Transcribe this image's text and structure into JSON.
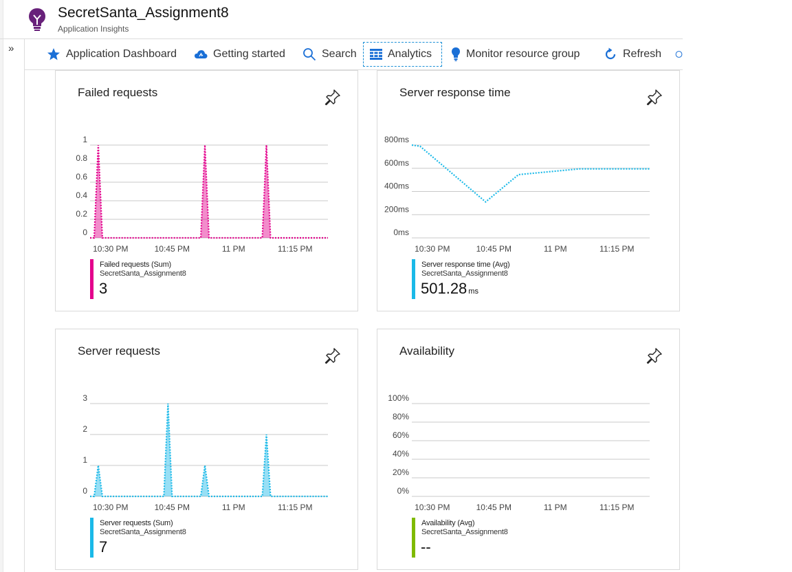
{
  "header": {
    "title": "SecretSanta_Assignment8",
    "subtitle": "Application Insights"
  },
  "nav": {
    "collapse_glyph": "»"
  },
  "toolbar": {
    "items": [
      {
        "label": "Application Dashboard",
        "icon": "star-icon"
      },
      {
        "label": "Getting started",
        "icon": "cloud-icon"
      },
      {
        "label": "Search",
        "icon": "search-icon"
      },
      {
        "label": "Analytics",
        "icon": "grid-icon",
        "active": true
      },
      {
        "label": "Monitor resource group",
        "icon": "bulb-icon"
      },
      {
        "label": "Refresh",
        "icon": "refresh-icon"
      }
    ]
  },
  "colors": {
    "magenta": "#e3008c",
    "cyan": "#1ab9e8",
    "green": "#7fba00",
    "accent": "#1a8fd6"
  },
  "tiles": [
    {
      "title": "Failed requests",
      "legend": {
        "label": "Failed requests (Sum)",
        "resource": "SecretSanta_Assignment8",
        "value": "3",
        "unit": ""
      }
    },
    {
      "title": "Server response time",
      "legend": {
        "label": "Server response time (Avg)",
        "resource": "SecretSanta_Assignment8",
        "value": "501.28",
        "unit": "ms"
      }
    },
    {
      "title": "Server requests",
      "legend": {
        "label": "Server requests (Sum)",
        "resource": "SecretSanta_Assignment8",
        "value": "7",
        "unit": ""
      }
    },
    {
      "title": "Availability",
      "legend": {
        "label": "Availability (Avg)",
        "resource": "SecretSanta_Assignment8",
        "value": "--",
        "unit": ""
      }
    }
  ],
  "chart_data": [
    {
      "type": "area",
      "title": "Failed requests",
      "x_ticks": [
        "10:30 PM",
        "10:45 PM",
        "11 PM",
        "11:15 PM"
      ],
      "y_ticks": [
        "0",
        "0.2",
        "0.4",
        "0.6",
        "0.8",
        "1"
      ],
      "ylim": [
        0,
        1
      ],
      "series": [
        {
          "name": "Failed requests (Sum)",
          "color": "#e3008c",
          "points": [
            {
              "x": "10:25 PM",
              "y": 0
            },
            {
              "x": "10:26 PM",
              "y": 0
            },
            {
              "x": "10:27 PM",
              "y": 1
            },
            {
              "x": "10:28 PM",
              "y": 0
            },
            {
              "x": "10:52 PM",
              "y": 0
            },
            {
              "x": "10:53 PM",
              "y": 1
            },
            {
              "x": "10:54 PM",
              "y": 0
            },
            {
              "x": "11:07 PM",
              "y": 0
            },
            {
              "x": "11:08 PM",
              "y": 1
            },
            {
              "x": "11:09 PM",
              "y": 0
            },
            {
              "x": "11:23 PM",
              "y": 0
            }
          ]
        }
      ]
    },
    {
      "type": "line",
      "title": "Server response time",
      "x_ticks": [
        "10:30 PM",
        "10:45 PM",
        "11 PM",
        "11:15 PM"
      ],
      "y_ticks": [
        "0ms",
        "200ms",
        "400ms",
        "600ms",
        "800ms"
      ],
      "ylim": [
        0,
        800
      ],
      "series": [
        {
          "name": "Server response time (Avg)",
          "color": "#1ab9e8",
          "points": [
            {
              "x": "10:25 PM",
              "y": 800
            },
            {
              "x": "10:27 PM",
              "y": 790
            },
            {
              "x": "10:43 PM",
              "y": 310
            },
            {
              "x": "10:51 PM",
              "y": 545
            },
            {
              "x": "11:06 PM",
              "y": 595
            },
            {
              "x": "11:23 PM",
              "y": 595
            }
          ]
        }
      ]
    },
    {
      "type": "area",
      "title": "Server requests",
      "x_ticks": [
        "10:30 PM",
        "10:45 PM",
        "11 PM",
        "11:15 PM"
      ],
      "y_ticks": [
        "0",
        "1",
        "2",
        "3"
      ],
      "ylim": [
        0,
        3
      ],
      "series": [
        {
          "name": "Server requests (Sum)",
          "color": "#1ab9e8",
          "points": [
            {
              "x": "10:25 PM",
              "y": 0
            },
            {
              "x": "10:26 PM",
              "y": 0
            },
            {
              "x": "10:27 PM",
              "y": 1
            },
            {
              "x": "10:28 PM",
              "y": 0
            },
            {
              "x": "10:43 PM",
              "y": 0
            },
            {
              "x": "10:44 PM",
              "y": 3
            },
            {
              "x": "10:45 PM",
              "y": 0
            },
            {
              "x": "10:52 PM",
              "y": 0
            },
            {
              "x": "10:53 PM",
              "y": 1
            },
            {
              "x": "10:54 PM",
              "y": 0
            },
            {
              "x": "11:07 PM",
              "y": 0
            },
            {
              "x": "11:08 PM",
              "y": 2
            },
            {
              "x": "11:09 PM",
              "y": 0
            },
            {
              "x": "11:23 PM",
              "y": 0
            }
          ]
        }
      ]
    },
    {
      "type": "line",
      "title": "Availability",
      "x_ticks": [
        "10:30 PM",
        "10:45 PM",
        "11 PM",
        "11:15 PM"
      ],
      "y_ticks": [
        "0%",
        "20%",
        "40%",
        "60%",
        "80%",
        "100%"
      ],
      "ylim": [
        0,
        100
      ],
      "series": [
        {
          "name": "Availability (Avg)",
          "color": "#7fba00",
          "points": []
        }
      ]
    }
  ]
}
